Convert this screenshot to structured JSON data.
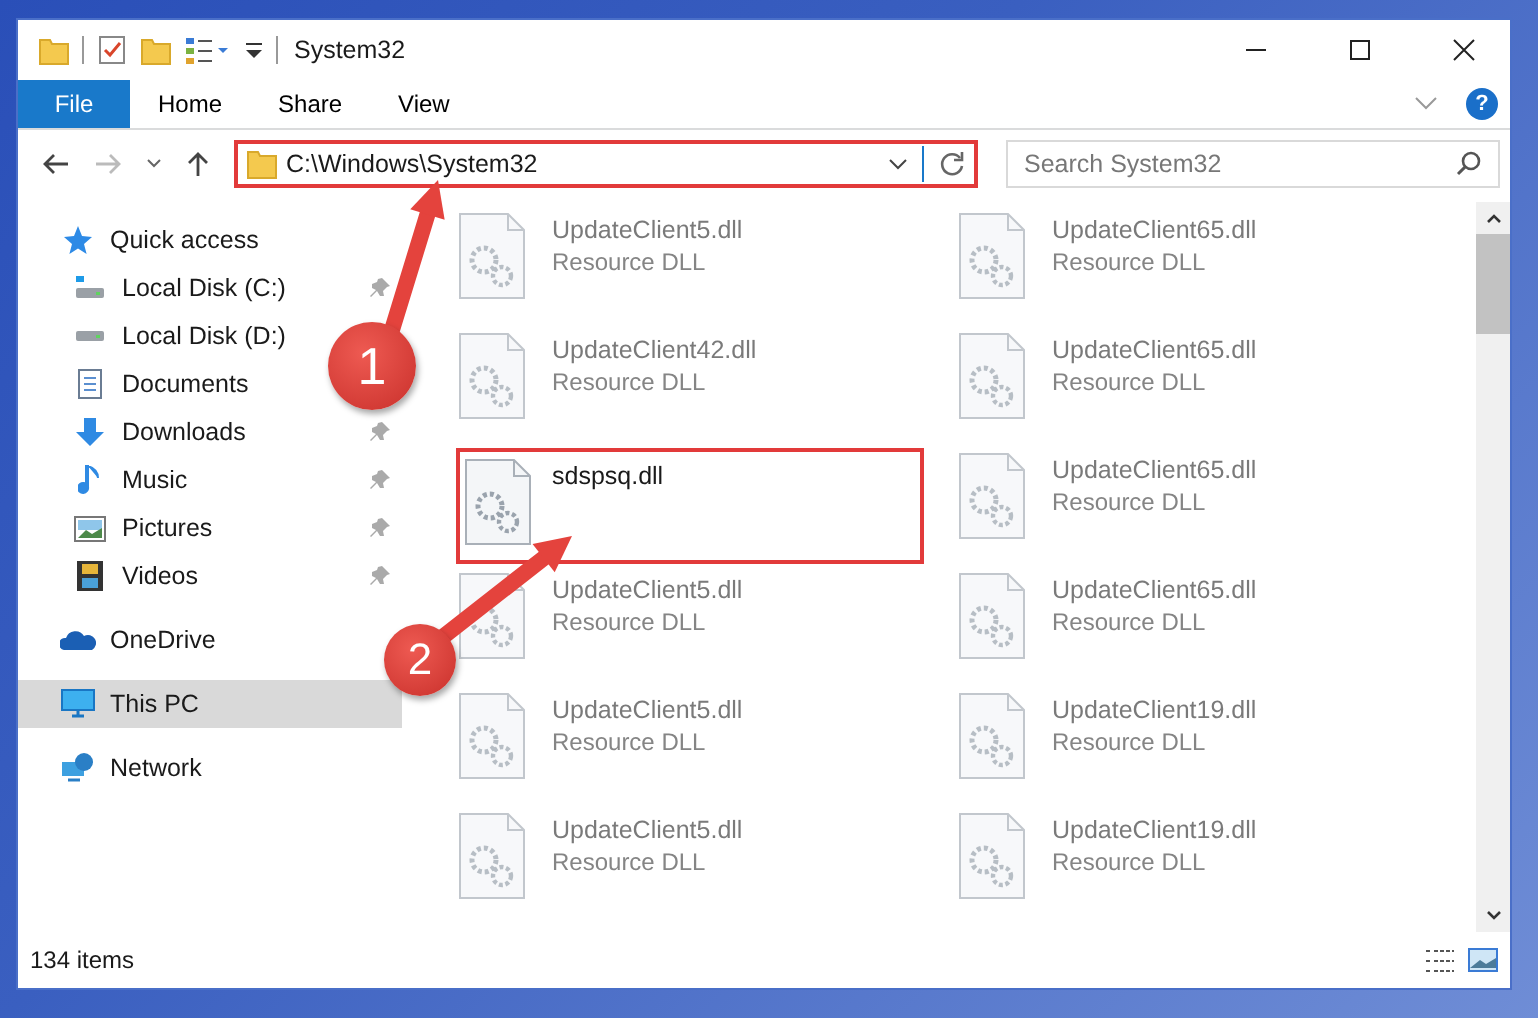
{
  "window": {
    "title": "System32"
  },
  "ribbon": {
    "file_tab": "File",
    "tabs": [
      "Home",
      "Share",
      "View"
    ],
    "help": "?"
  },
  "address": {
    "path": "C:\\Windows\\System32",
    "highlighted": true
  },
  "search": {
    "placeholder": "Search System32"
  },
  "sidebar": {
    "items": [
      {
        "label": "Quick access",
        "kind": "star",
        "selected": false,
        "children": [
          {
            "label": "Local Disk (C:)",
            "kind": "sysdrive",
            "selected": false,
            "pinned": true
          },
          {
            "label": "Local Disk (D:)",
            "kind": "drive",
            "selected": false
          },
          {
            "label": "Documents",
            "kind": "document",
            "selected": false
          },
          {
            "label": "Downloads",
            "kind": "download",
            "selected": false,
            "pinned": true
          },
          {
            "label": "Music",
            "kind": "music",
            "selected": false,
            "pinned": true
          },
          {
            "label": "Pictures",
            "kind": "pictures",
            "selected": false,
            "pinned": true
          },
          {
            "label": "Videos",
            "kind": "videos",
            "selected": false,
            "pinned": true
          }
        ]
      },
      {
        "label": "OneDrive",
        "kind": "cloud",
        "selected": false
      },
      {
        "label": "This PC",
        "kind": "pc",
        "selected": true
      },
      {
        "label": "Network",
        "kind": "network",
        "selected": false
      }
    ]
  },
  "files": [
    {
      "name": "UpdateClient5.dll",
      "type": "Resource DLL",
      "blurred": true,
      "highlighted": false
    },
    {
      "name": "UpdateClient65.dll",
      "type": "Resource DLL",
      "blurred": true,
      "highlighted": false
    },
    {
      "name": "UpdateClient42.dll",
      "type": "Resource DLL",
      "blurred": true,
      "highlighted": false
    },
    {
      "name": "UpdateClient65.dll",
      "type": "Resource DLL",
      "blurred": true,
      "highlighted": false
    },
    {
      "name": "sdspsq.dll",
      "blurred": false,
      "highlighted": true
    },
    {
      "name": "UpdateClient65.dll",
      "type": "Resource DLL",
      "blurred": true,
      "highlighted": false
    },
    {
      "name": "UpdateClient5.dll",
      "type": "Resource DLL",
      "blurred": true,
      "highlighted": false
    },
    {
      "name": "UpdateClient65.dll",
      "type": "Resource DLL",
      "blurred": true,
      "highlighted": false
    },
    {
      "name": "UpdateClient5.dll",
      "type": "Resource DLL",
      "blurred": true,
      "highlighted": false
    },
    {
      "name": "UpdateClient19.dll",
      "type": "Resource DLL",
      "blurred": true,
      "highlighted": false
    },
    {
      "name": "UpdateClient5.dll",
      "type": "Resource DLL",
      "blurred": true,
      "highlighted": false
    },
    {
      "name": "UpdateClient19.dll",
      "type": "Resource DLL",
      "blurred": true,
      "highlighted": false
    }
  ],
  "status_bar": {
    "count": "134 items"
  },
  "callouts": [
    {
      "number": "1"
    },
    {
      "number": "2"
    }
  ]
}
